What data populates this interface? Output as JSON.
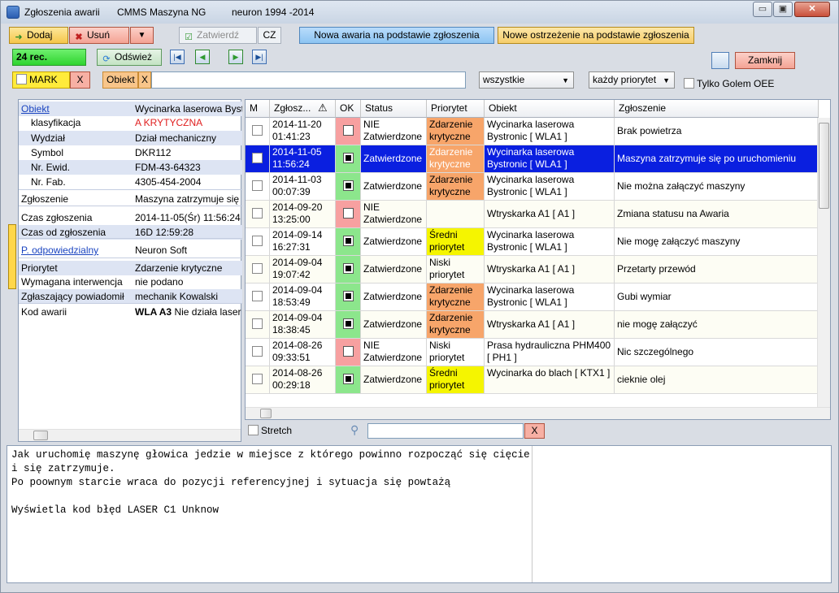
{
  "window": {
    "title_app": "Zgłoszenia awarii",
    "title_product": "CMMS Maszyna NG",
    "title_copyright": "neuron 1994 -2014",
    "minimize": "▭",
    "maximize": "▣",
    "close": "✕"
  },
  "toolbar": {
    "add_label": "Dodaj",
    "delete_label": "Usuń",
    "more_label": "▼",
    "approve_label": "Zatwierdź",
    "cz_label": "CZ",
    "new_failure_label": "Nowa awaria na podstawie zgłoszenia",
    "new_warning_label": "Nowe ostrzeżenie na podstawie zgłoszenia",
    "record_count": "24 rec.",
    "refresh_label": "Odśwież",
    "close_label": "Zamknij"
  },
  "filters": {
    "mark_label": "MARK",
    "mark_clear": "X",
    "object_label": "Obiekt",
    "object_clear": "X",
    "object_value": "",
    "status_select": "wszystkie",
    "priority_select": "każdy priorytet",
    "golem_label": "Tylko Golem OEE"
  },
  "details": [
    {
      "key": "Obiekt",
      "value": "Wycinarka laserowa Bystronic",
      "link": true,
      "shade": true
    },
    {
      "key": "klasyfikacja",
      "value": "A  KRYTYCZNA",
      "indent": true,
      "red": true
    },
    {
      "key": "Wydział",
      "value": "Dział mechaniczny",
      "indent": true,
      "shade": true
    },
    {
      "key": "Symbol",
      "value": "DKR112",
      "indent": true
    },
    {
      "key": "Nr. Ewid.",
      "value": "FDM-43-64323",
      "indent": true,
      "shade": true
    },
    {
      "key": "Nr. Fab.",
      "value": "4305-454-2004",
      "indent": true
    },
    {
      "key": "Zgłoszenie",
      "value": "Maszyna zatrzymuje się po uruchomieniu"
    },
    {
      "key": "Czas zgłoszenia",
      "value": "2014-11-05(Śr) 11:56:24"
    },
    {
      "key": "Czas od zgłoszenia",
      "value": "16D 12:59:28",
      "shade": true
    },
    {
      "key": "P. odpowiedzialny",
      "value": "Neuron Soft",
      "link": true
    },
    {
      "key": "Priorytet",
      "value": "Zdarzenie krytyczne",
      "shade": true
    },
    {
      "key": "Wymagana interwencja",
      "value": "nie podano"
    },
    {
      "key": "Zgłaszający powiadomił",
      "value": "mechanik Kowalski",
      "shade": true
    },
    {
      "key": "Kod awarii",
      "value_bold": "WLA A3",
      "value": "Nie działa laser"
    }
  ],
  "grid": {
    "headers": [
      "M",
      "Zgłosz...",
      "OK",
      "Status",
      "Priorytet",
      "Obiekt",
      "Zgłoszenie"
    ],
    "stretch_label": "Stretch",
    "search_clear": "X",
    "rows": [
      {
        "date": "2014-11-20",
        "time": "01:41:23",
        "ok": false,
        "status": "NIE Zatwierdzone",
        "priority": "Zdarzenie krytyczne",
        "pcolor": "#f7a56a",
        "object": "Wycinarka laserowa Bystronic [ WLA1 ]",
        "report": "Brak powietrza",
        "selected": false
      },
      {
        "date": "2014-11-05",
        "time": "11:56:24",
        "ok": true,
        "status": "Zatwierdzone",
        "priority": "Zdarzenie krytyczne",
        "pcolor": "#f7a56a",
        "object": "Wycinarka laserowa Bystronic [ WLA1 ]",
        "report": "Maszyna zatrzymuje się po uruchomieniu",
        "selected": true
      },
      {
        "date": "2014-11-03",
        "time": "00:07:39",
        "ok": true,
        "status": "Zatwierdzone",
        "priority": "Zdarzenie krytyczne",
        "pcolor": "#f7a56a",
        "object": "Wycinarka laserowa Bystronic [ WLA1 ]",
        "report": "Nie można załączyć maszyny",
        "selected": false
      },
      {
        "date": "2014-09-20",
        "time": "13:25:00",
        "ok": false,
        "status": "NIE Zatwierdzone",
        "priority": "",
        "pcolor": "",
        "object": "Wtryskarka A1 [ A1 ]",
        "report": "Zmiana statusu na Awaria",
        "selected": false
      },
      {
        "date": "2014-09-14",
        "time": "16:27:31",
        "ok": true,
        "status": "Zatwierdzone",
        "priority": "Średni priorytet",
        "pcolor": "#f5f500",
        "object": "Wycinarka laserowa Bystronic [ WLA1 ]",
        "report": "Nie mogę załączyć maszyny",
        "selected": false
      },
      {
        "date": "2014-09-04",
        "time": "19:07:42",
        "ok": true,
        "status": "Zatwierdzone",
        "priority": "Niski priorytet",
        "pcolor": "",
        "object": "Wtryskarka A1 [ A1 ]",
        "report": "Przetarty przewód",
        "selected": false
      },
      {
        "date": "2014-09-04",
        "time": "18:53:49",
        "ok": true,
        "status": "Zatwierdzone",
        "priority": "Zdarzenie krytyczne",
        "pcolor": "#f7a56a",
        "object": "Wycinarka laserowa Bystronic [ WLA1 ]",
        "report": "Gubi wymiar",
        "selected": false
      },
      {
        "date": "2014-09-04",
        "time": "18:38:45",
        "ok": true,
        "status": "Zatwierdzone",
        "priority": "Zdarzenie krytyczne",
        "pcolor": "#f7a56a",
        "object": "Wtryskarka A1 [ A1 ]",
        "report": "nie mogę załączyć",
        "selected": false
      },
      {
        "date": "2014-08-26",
        "time": "09:33:51",
        "ok": false,
        "status": "NIE Zatwierdzone",
        "priority": "Niski priorytet",
        "pcolor": "",
        "object": "Prasa hydrauliczna PHM400 [ PH1 ]",
        "report": "Nic szczególnego",
        "selected": false
      },
      {
        "date": "2014-08-26",
        "time": "00:29:18",
        "ok": true,
        "status": "Zatwierdzone",
        "priority": "Średni priorytet",
        "pcolor": "#f5f500",
        "object": "Wycinarka do blach [ KTX1 ]",
        "report": "cieknie olej",
        "selected": false
      }
    ]
  },
  "note_text": "Jak uruchomię maszynę głowica jedzie w miejsce z którego powinno rozpocząć się cięcie\ni się zatrzymuje.\nPo poownym starcie wraca do pozycji referencyjnej i sytuacja się powtażą\n\nWyświetla kod błęd LASER C1 Unknow",
  "colors": {
    "selection": "#0a1fe0",
    "ok_green": "#8ce68c",
    "not_ok_red": "#f7a0a0",
    "record_green": "#3ee03e"
  }
}
